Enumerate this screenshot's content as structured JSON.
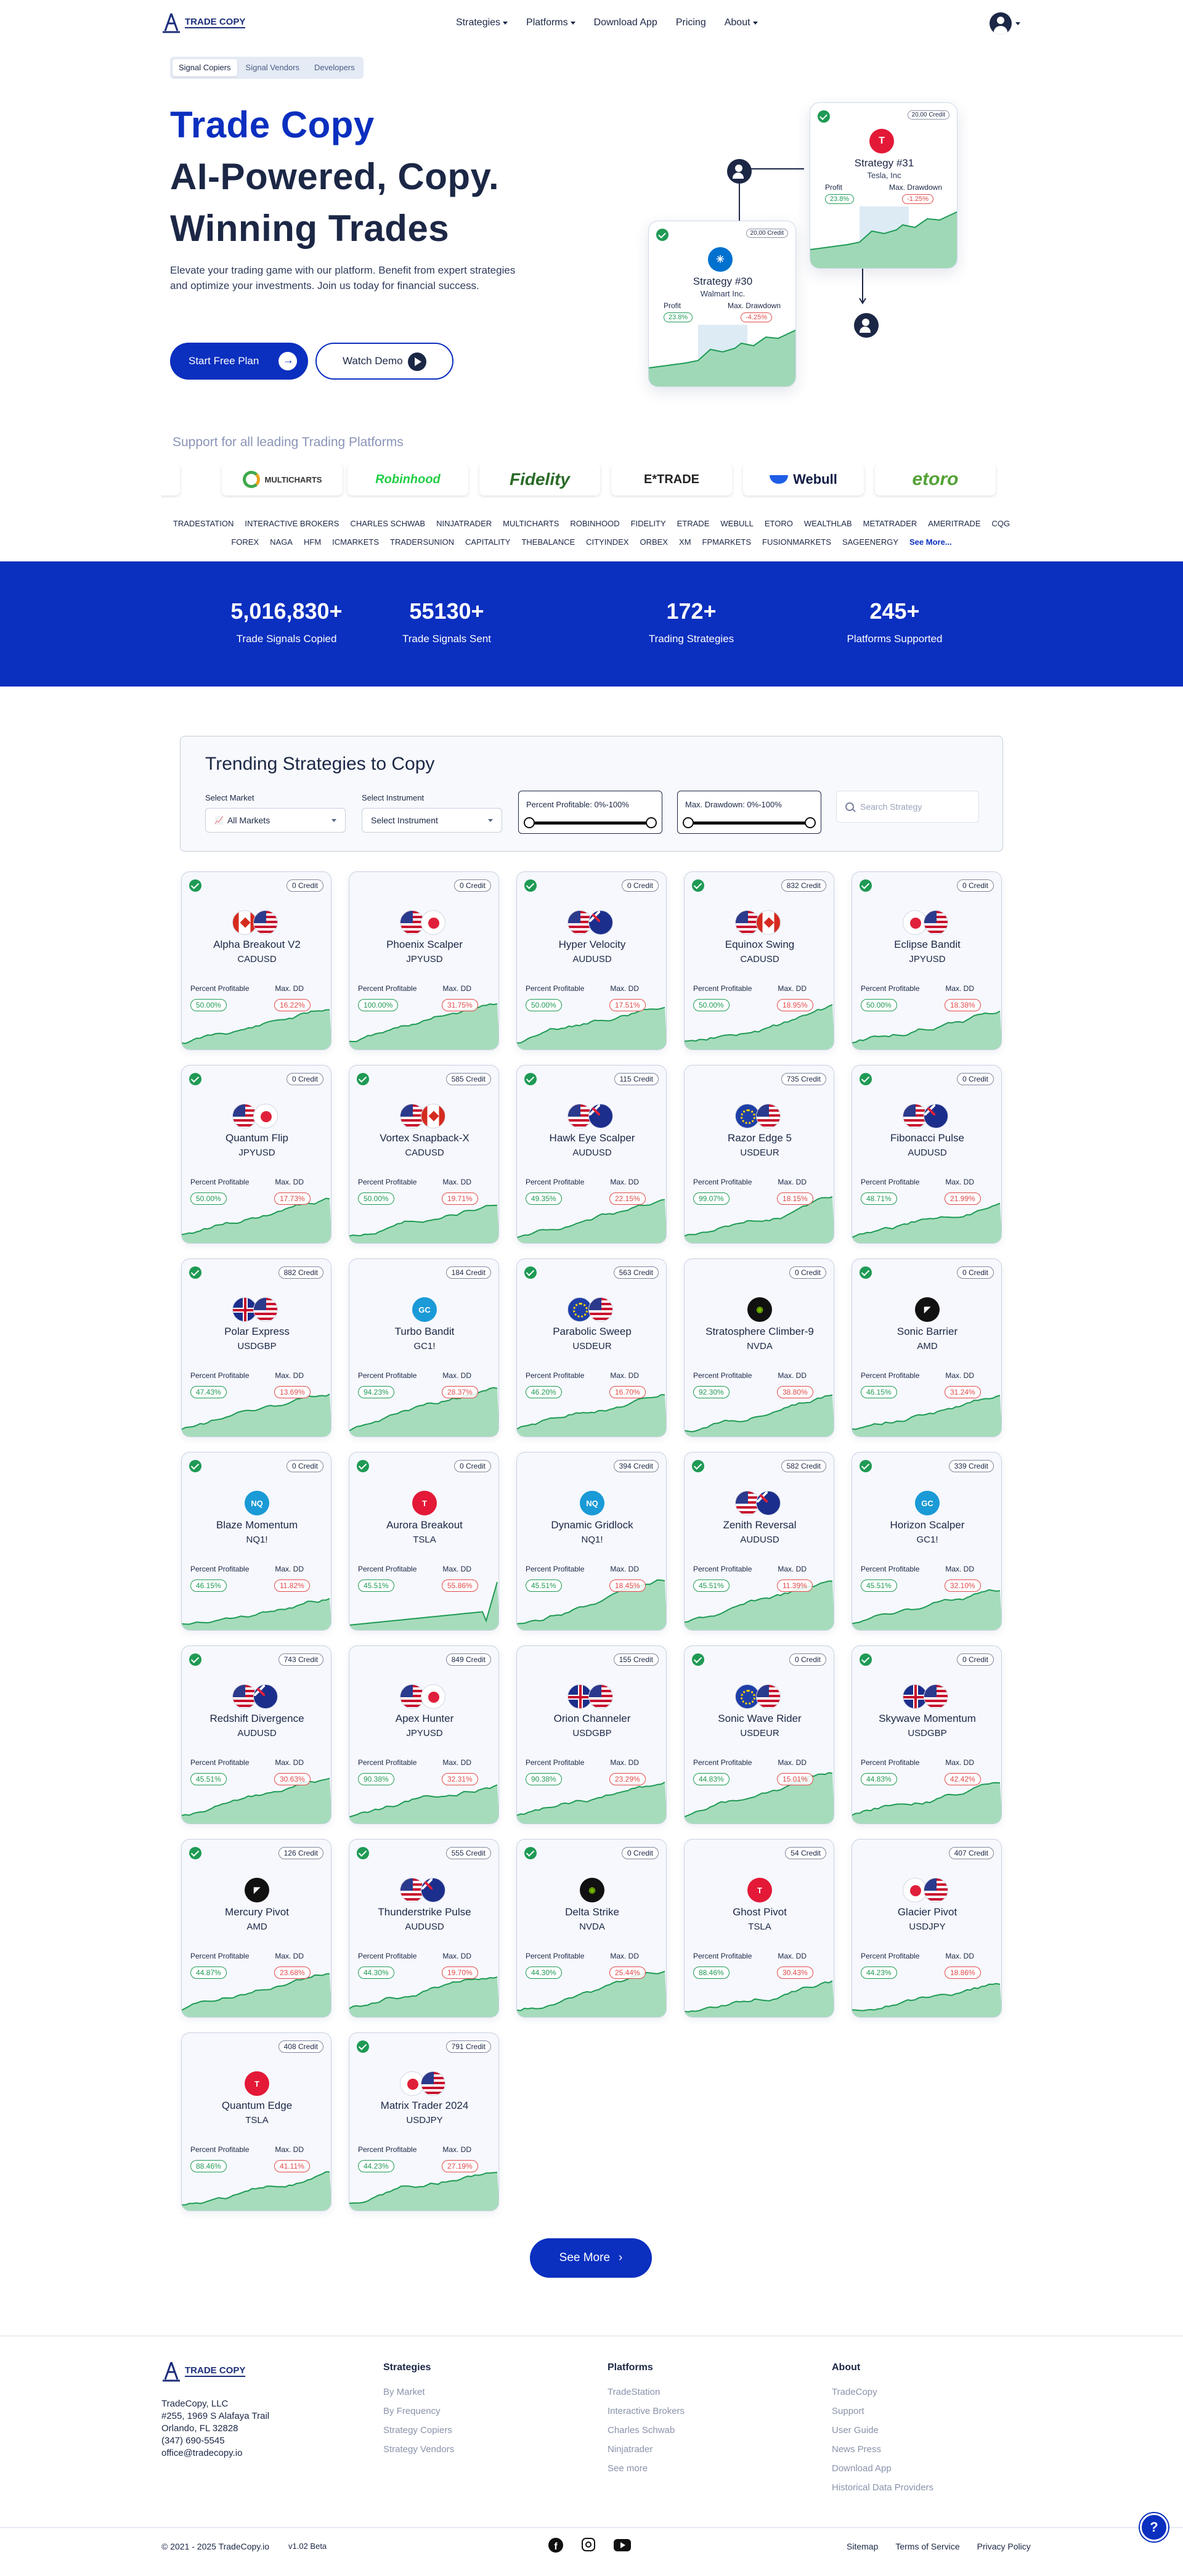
{
  "header": {
    "logo_text": "TRADE COPY",
    "nav": [
      {
        "label": "Strategies",
        "dropdown": true
      },
      {
        "label": "Platforms",
        "dropdown": true
      },
      {
        "label": "Download App",
        "dropdown": false
      },
      {
        "label": "Pricing",
        "dropdown": false
      },
      {
        "label": "About",
        "dropdown": true
      }
    ]
  },
  "hero": {
    "tabs": [
      "Signal Copiers",
      "Signal Vendors",
      "Developers"
    ],
    "active_tab": 0,
    "title_line1": "Trade Copy",
    "title_line2": "AI-Powered, Copy.",
    "title_line3": "Winning Trades",
    "description": "Elevate your trading game with our platform. Benefit from expert strategies and optimize your investments. Join us today for financial success.",
    "cta_primary": "Start Free Plan",
    "cta_secondary": "Watch Demo",
    "preview_cards": [
      {
        "credit": "20,00 Credit",
        "name": "Strategy #31",
        "sub": "Tesla, Inc",
        "label1": "Profit",
        "label2": "Max. Drawdown",
        "value1": "23.8%",
        "value2": "-1.25%",
        "logo": "tesla-icon",
        "color": "#e31937"
      },
      {
        "credit": "20,00 Credit",
        "name": "Strategy #30",
        "sub": "Walmart Inc.",
        "label1": "Profit",
        "label2": "Max. Drawdown",
        "value1": "23.8%",
        "value2": "-4.25%",
        "logo": "walmart-icon",
        "color": "#0071ce"
      }
    ]
  },
  "platforms": {
    "heading": "Support for all leading Trading Platforms",
    "logos": [
      "MULTICHARTS",
      "Robinhood",
      "Fidelity",
      "E*TRADE",
      "Webull",
      "etoro"
    ],
    "row1": [
      "TRADESTATION",
      "INTERACTIVE BROKERS",
      "CHARLES SCHWAB",
      "NINJATRADER",
      "MULTICHARTS",
      "ROBINHOOD",
      "FIDELITY",
      "ETRADE",
      "WEBULL",
      "ETORO",
      "WEALTHLAB",
      "METATRADER",
      "AMERITRADE",
      "CQG"
    ],
    "row2": [
      "FOREX",
      "NAGA",
      "HFM",
      "ICMARKETS",
      "TRADERSUNION",
      "CAPITALITY",
      "THEBALANCE",
      "CITYINDEX",
      "ORBEX",
      "XM",
      "FPMARKETS",
      "FUSIONMARKETS",
      "SAGEENERGY"
    ],
    "see_more": "See More..."
  },
  "stats": [
    {
      "value": "5,016,830+",
      "label": "Trade Signals Copied"
    },
    {
      "value": "55130+",
      "label": "Trade Signals Sent"
    },
    {
      "value": "172+",
      "label": "Trading Strategies"
    },
    {
      "value": "245+",
      "label": "Platforms Supported"
    }
  ],
  "trending": {
    "title": "Trending Strategies to Copy",
    "market_label": "Select Market",
    "market_value": "All Markets",
    "instrument_label": "Select Instrument",
    "instrument_value": "Select Instrument",
    "profit_range": "Percent Profitable: 0%-100%",
    "drawdown_range": "Max. Drawdown: 0%-100%",
    "search_placeholder": "Search Strategy",
    "label_profit": "Percent Profitable",
    "label_dd": "Max. DD"
  },
  "cards": [
    {
      "name": "Alpha Breakout V2",
      "sym": "CADUSD",
      "credit": "0 Credit",
      "pp": "50.00%",
      "dd": "16.22%",
      "check": true,
      "icons": [
        "ca",
        "us"
      ]
    },
    {
      "name": "Phoenix Scalper",
      "sym": "JPYUSD",
      "credit": "0 Credit",
      "pp": "100.00%",
      "dd": "31.75%",
      "check": false,
      "icons": [
        "us",
        "jp"
      ]
    },
    {
      "name": "Hyper Velocity",
      "sym": "AUDUSD",
      "credit": "0 Credit",
      "pp": "50.00%",
      "dd": "17.51%",
      "check": true,
      "icons": [
        "us",
        "au"
      ]
    },
    {
      "name": "Equinox Swing",
      "sym": "CADUSD",
      "credit": "832 Credit",
      "pp": "50.00%",
      "dd": "18.95%",
      "check": true,
      "icons": [
        "us",
        "ca"
      ]
    },
    {
      "name": "Eclipse Bandit",
      "sym": "JPYUSD",
      "credit": "0 Credit",
      "pp": "50.00%",
      "dd": "18.38%",
      "check": true,
      "icons": [
        "jp",
        "us"
      ]
    },
    {
      "name": "Quantum Flip",
      "sym": "JPYUSD",
      "credit": "0 Credit",
      "pp": "50.00%",
      "dd": "17.73%",
      "check": true,
      "icons": [
        "us",
        "jp"
      ]
    },
    {
      "name": "Vortex Snapback-X",
      "sym": "CADUSD",
      "credit": "585 Credit",
      "pp": "50.00%",
      "dd": "19.71%",
      "check": true,
      "icons": [
        "us",
        "ca"
      ]
    },
    {
      "name": "Hawk Eye Scalper",
      "sym": "AUDUSD",
      "credit": "115 Credit",
      "pp": "49.35%",
      "dd": "22.15%",
      "check": true,
      "icons": [
        "us",
        "au"
      ]
    },
    {
      "name": "Razor Edge 5",
      "sym": "USDEUR",
      "credit": "735 Credit",
      "pp": "99.07%",
      "dd": "18.15%",
      "check": false,
      "icons": [
        "eu",
        "us"
      ]
    },
    {
      "name": "Fibonacci Pulse",
      "sym": "AUDUSD",
      "credit": "0 Credit",
      "pp": "48.71%",
      "dd": "21.99%",
      "check": true,
      "icons": [
        "us",
        "au"
      ]
    },
    {
      "name": "Polar Express",
      "sym": "USDGBP",
      "credit": "882 Credit",
      "pp": "47.43%",
      "dd": "13.69%",
      "check": true,
      "icons": [
        "gb",
        "us"
      ]
    },
    {
      "name": "Turbo Bandit",
      "sym": "GC1!",
      "credit": "184 Credit",
      "pp": "94.23%",
      "dd": "28.37%",
      "check": false,
      "icons": [
        "gc"
      ]
    },
    {
      "name": "Parabolic Sweep",
      "sym": "USDEUR",
      "credit": "563 Credit",
      "pp": "46.20%",
      "dd": "16.70%",
      "check": true,
      "icons": [
        "eu",
        "us"
      ]
    },
    {
      "name": "Stratosphere Climber-9",
      "sym": "NVDA",
      "credit": "0 Credit",
      "pp": "92.30%",
      "dd": "38.80%",
      "check": false,
      "icons": [
        "nvda"
      ]
    },
    {
      "name": "Sonic Barrier",
      "sym": "AMD",
      "credit": "0 Credit",
      "pp": "46.15%",
      "dd": "31.24%",
      "check": true,
      "icons": [
        "amd"
      ]
    },
    {
      "name": "Blaze Momentum",
      "sym": "NQ1!",
      "credit": "0 Credit",
      "pp": "46.15%",
      "dd": "11.82%",
      "check": true,
      "icons": [
        "nq"
      ]
    },
    {
      "name": "Aurora Breakout",
      "sym": "TSLA",
      "credit": "0 Credit",
      "pp": "45.51%",
      "dd": "55.86%",
      "check": true,
      "icons": [
        "tsla"
      ]
    },
    {
      "name": "Dynamic Gridlock",
      "sym": "NQ1!",
      "credit": "394 Credit",
      "pp": "45.51%",
      "dd": "18.45%",
      "check": false,
      "icons": [
        "nq"
      ]
    },
    {
      "name": "Zenith Reversal",
      "sym": "AUDUSD",
      "credit": "582 Credit",
      "pp": "45.51%",
      "dd": "11.39%",
      "check": true,
      "icons": [
        "us",
        "au"
      ]
    },
    {
      "name": "Horizon Scalper",
      "sym": "GC1!",
      "credit": "339 Credit",
      "pp": "45.51%",
      "dd": "32.10%",
      "check": true,
      "icons": [
        "gc"
      ]
    },
    {
      "name": "Redshift Divergence",
      "sym": "AUDUSD",
      "credit": "743 Credit",
      "pp": "45.51%",
      "dd": "30.63%",
      "check": true,
      "icons": [
        "us",
        "au"
      ]
    },
    {
      "name": "Apex Hunter",
      "sym": "JPYUSD",
      "credit": "849 Credit",
      "pp": "90.38%",
      "dd": "32.31%",
      "check": false,
      "icons": [
        "us",
        "jp"
      ]
    },
    {
      "name": "Orion Channeler",
      "sym": "USDGBP",
      "credit": "155 Credit",
      "pp": "90.38%",
      "dd": "23.29%",
      "check": false,
      "icons": [
        "gb",
        "us"
      ]
    },
    {
      "name": "Sonic Wave Rider",
      "sym": "USDEUR",
      "credit": "0 Credit",
      "pp": "44.83%",
      "dd": "15.01%",
      "check": true,
      "icons": [
        "eu",
        "us"
      ]
    },
    {
      "name": "Skywave Momentum",
      "sym": "USDGBP",
      "credit": "0 Credit",
      "pp": "44.83%",
      "dd": "42.42%",
      "check": true,
      "icons": [
        "gb",
        "us"
      ]
    },
    {
      "name": "Mercury Pivot",
      "sym": "AMD",
      "credit": "126 Credit",
      "pp": "44.87%",
      "dd": "23.68%",
      "check": true,
      "icons": [
        "amd"
      ]
    },
    {
      "name": "Thunderstrike Pulse",
      "sym": "AUDUSD",
      "credit": "555 Credit",
      "pp": "44.30%",
      "dd": "19.70%",
      "check": true,
      "icons": [
        "us",
        "au"
      ]
    },
    {
      "name": "Delta Strike",
      "sym": "NVDA",
      "credit": "0 Credit",
      "pp": "44.30%",
      "dd": "25.44%",
      "check": true,
      "icons": [
        "nvda"
      ]
    },
    {
      "name": "Ghost Pivot",
      "sym": "TSLA",
      "credit": "54 Credit",
      "pp": "88.46%",
      "dd": "30.43%",
      "check": false,
      "icons": [
        "tsla"
      ]
    },
    {
      "name": "Glacier Pivot",
      "sym": "USDJPY",
      "credit": "407 Credit",
      "pp": "44.23%",
      "dd": "18.86%",
      "check": false,
      "icons": [
        "jp",
        "us"
      ]
    },
    {
      "name": "Quantum Edge",
      "sym": "TSLA",
      "credit": "408 Credit",
      "pp": "88.46%",
      "dd": "41.11%",
      "check": false,
      "icons": [
        "tsla"
      ]
    },
    {
      "name": "Matrix Trader 2024",
      "sym": "USDJPY",
      "credit": "791 Credit",
      "pp": "44.23%",
      "dd": "27.19%",
      "check": true,
      "icons": [
        "jp",
        "us"
      ]
    }
  ],
  "see_more_button": "See More",
  "footer": {
    "logo_text": "TRADE COPY",
    "address": [
      "TradeCopy, LLC",
      "#255, 1969 S Alafaya Trail",
      "Orlando, FL 32828",
      "(347) 690-5545",
      "office@tradecopy.io"
    ],
    "columns": [
      {
        "title": "Strategies",
        "items": [
          "By Market",
          "By Frequency",
          "Strategy Copiers",
          "Strategy Vendors"
        ]
      },
      {
        "title": "Platforms",
        "items": [
          "TradeStation",
          "Interactive Brokers",
          "Charles Schwab",
          "Ninjatrader",
          "See more"
        ]
      },
      {
        "title": "About",
        "items": [
          "TradeCopy",
          "Support",
          "User Guide",
          "News Press",
          "Download App",
          "Historical Data Providers"
        ]
      }
    ],
    "copyright": "© 2021 - 2025 TradeCopy.io",
    "version": "v1.02 Beta",
    "links": [
      "Sitemap",
      "Terms of Service",
      "Privacy Policy"
    ]
  },
  "colors": {
    "brand": "#0b2fbf",
    "navy": "#1c2746",
    "green": "#1f9a55",
    "red": "#e24a4a"
  }
}
